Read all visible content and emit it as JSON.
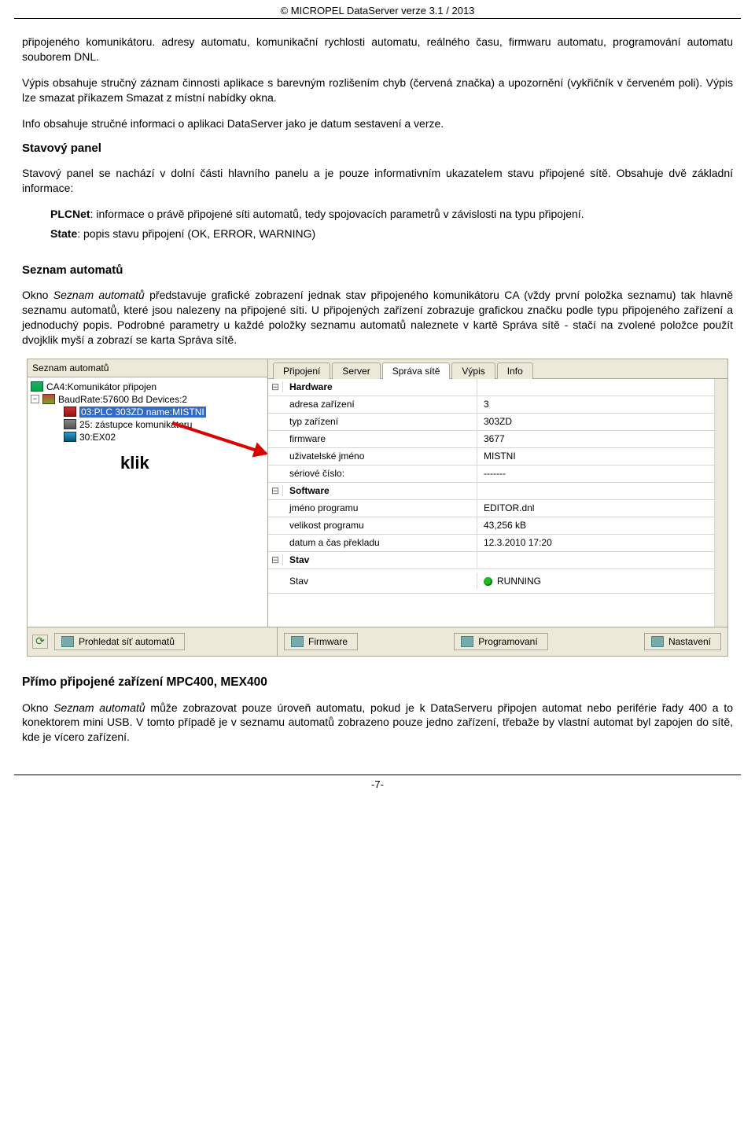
{
  "header": {
    "copyright": "© MICROPEL DataServer verze 3.1 / 2013"
  },
  "intro": {
    "p1": "připojeného komunikátoru. adresy automatu, komunikační rychlosti automatu, reálného času, firmwaru automatu, programování automatu souborem DNL.",
    "p2": "Výpis obsahuje stručný záznam činnosti aplikace s barevným rozlišením chyb (červená značka) a upozornění (vykřičník v červeném poli). Výpis lze smazat příkazem Smazat z místní nabídky okna.",
    "p3": "Info obsahuje stručné informaci o aplikaci DataServer jako je datum sestavení a verze."
  },
  "stav": {
    "title": "Stavový panel",
    "p1": "Stavový panel se nachází v dolní části hlavního panelu a je pouze informativním ukazatelem stavu připojené sítě. Obsahuje dvě základní informace:",
    "plc_label": "PLCNet",
    "plc_text": ": informace o právě připojené síti automatů, tedy spojovacích parametrů v závislosti na typu připojení.",
    "state_label": "State",
    "state_text": ": popis stavu připojení (OK, ERROR, WARNING)"
  },
  "seznam": {
    "title": "Seznam automatů",
    "p1_a": "Okno ",
    "p1_em": "Seznam automatů",
    "p1_b": " představuje grafické zobrazení jednak stav připojeného komunikátoru CA (vždy první položka seznamu) tak hlavně seznamu automatů, které jsou nalezeny na připojené síti. U připojených zařízení zobrazuje grafickou značku podle typu připojeného zařízení a jednoduchý popis. Podrobné parametry u každé položky seznamu automatů naleznete v kartě Správa sítě - stačí na zvolené položce použít dvojklik myší a zobrazí se karta Správa sítě."
  },
  "shot": {
    "left_title": "Seznam automatů",
    "tree": {
      "ca": "CA4:Komunikátor připojen",
      "bus": "BaudRate:57600 Bd Devices:2",
      "plc": "03:PLC 303ZD name:MISTNI",
      "prx": "25: zástupce komunikátoru",
      "ex": "30:EX02"
    },
    "klik": "klik",
    "tabs": [
      "Připojení",
      "Server",
      "Správa sítě",
      "Výpis",
      "Info"
    ],
    "grid": {
      "g1": "Hardware",
      "r1": {
        "l": "adresa zařízení",
        "v": "3"
      },
      "r2": {
        "l": "typ zařízení",
        "v": "303ZD"
      },
      "r3": {
        "l": "firmware",
        "v": "3677"
      },
      "r4": {
        "l": "uživatelské jméno",
        "v": "MISTNI"
      },
      "r5": {
        "l": "sériové číslo:",
        "v": "-------"
      },
      "g2": "Software",
      "r6": {
        "l": "jméno programu",
        "v": "EDITOR.dnl"
      },
      "r7": {
        "l": "velikost programu",
        "v": "43,256 kB"
      },
      "r8": {
        "l": "datum a čas překladu",
        "v": "12.3.2010 17:20"
      },
      "g3": "Stav",
      "r9": {
        "l": "Stav",
        "v": "RUNNING"
      }
    },
    "buttons": {
      "scan": "Prohledat síť automatů",
      "fw": "Firmware",
      "prog": "Programovaní",
      "set": "Nastavení"
    }
  },
  "mpc": {
    "title": "Přímo připojené zařízení MPC400, MEX400",
    "p1_a": "Okno ",
    "p1_em": "Seznam automatů",
    "p1_b": " může zobrazovat pouze úroveň automatu, pokud je k DataServeru připojen automat nebo periférie řady 400 a to konektorem mini USB. V tomto případě je v seznamu automatů zobrazeno pouze jedno zařízení, třebaže by vlastní automat byl zapojen do sítě, kde je vícero zařízení."
  },
  "footer": {
    "page": "-7-"
  }
}
